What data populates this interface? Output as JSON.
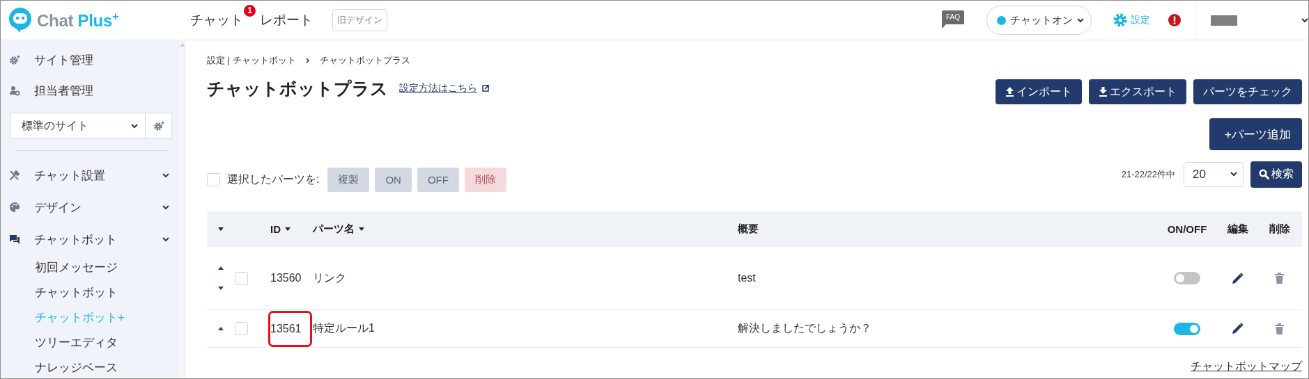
{
  "header": {
    "logo": {
      "word": "Chat",
      "accent": "Plus",
      "mark": "+"
    },
    "nav": [
      {
        "label": "チャット",
        "badge": "1"
      },
      {
        "label": "レポート"
      }
    ],
    "old_design_button": "旧デザイン",
    "faq_label": "FAQ",
    "status": {
      "label": "チャットオン",
      "on": true
    },
    "settings_label": "設定"
  },
  "sidebar": {
    "top_items": [
      {
        "label": "サイト管理"
      },
      {
        "label": "担当者管理"
      }
    ],
    "site_select": "標準のサイト",
    "sections": [
      {
        "label": "チャット設置"
      },
      {
        "label": "デザイン"
      },
      {
        "label": "チャットボット",
        "children": [
          {
            "label": "初回メッセージ",
            "selected": false
          },
          {
            "label": "チャットボット",
            "selected": false
          },
          {
            "label": "チャットボット+",
            "selected": true
          },
          {
            "label": "ツリーエディタ",
            "selected": false
          },
          {
            "label": "ナレッジベース",
            "selected": false
          }
        ]
      }
    ]
  },
  "breadcrumb": [
    "設定 | チャットボット",
    "チャットボットプラス"
  ],
  "page_title": "チャットボットプラス",
  "help_link": "設定方法はこちら",
  "toolbar_buttons": [
    {
      "label": "インポート"
    },
    {
      "label": "エクスポート"
    },
    {
      "label": "パーツをチェック"
    }
  ],
  "add_button": "+パーツ追加",
  "bulk": {
    "checked": false,
    "label": "選択したパーツを:",
    "buttons": [
      {
        "label": "複製",
        "kind": "neutral"
      },
      {
        "label": "ON",
        "kind": "neutral"
      },
      {
        "label": "OFF",
        "kind": "neutral"
      },
      {
        "label": "削除",
        "kind": "danger"
      }
    ]
  },
  "count": "21-22/22件中",
  "per_page": "20",
  "search_button": "検索",
  "table": {
    "columns": [
      {
        "label": "ID",
        "sortable": true
      },
      {
        "label": "パーツ名",
        "sortable": true
      },
      {
        "label": "概要",
        "sortable": false
      },
      {
        "label": "ON/OFF",
        "sortable": false
      },
      {
        "label": "編集",
        "sortable": false
      },
      {
        "label": "削除",
        "sortable": false
      }
    ],
    "rows": [
      {
        "move_up": true,
        "move_down": true,
        "checked": false,
        "id": "13560",
        "name": "リンク",
        "summary": "test",
        "on": false,
        "highlighted": false
      },
      {
        "move_up": true,
        "move_down": false,
        "checked": false,
        "id": "13561",
        "name": "特定ルール1",
        "summary": "解決しましたでしょうか？",
        "on": true,
        "highlighted": true
      }
    ]
  },
  "footer_link": "チャットボットマップ"
}
